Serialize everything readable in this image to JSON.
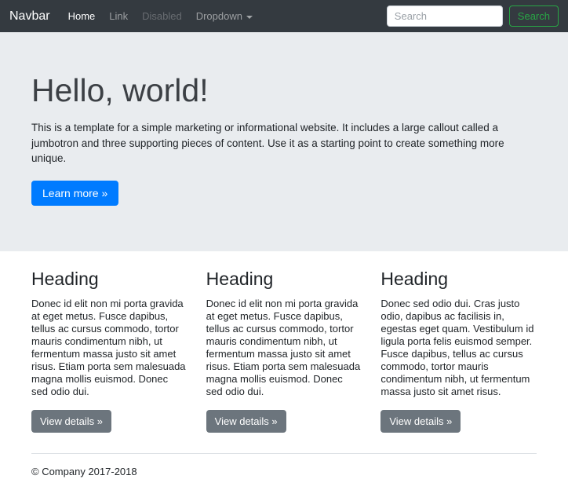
{
  "navbar": {
    "brand": "Navbar",
    "items": [
      {
        "label": "Home",
        "state": "active"
      },
      {
        "label": "Link",
        "state": "normal"
      },
      {
        "label": "Disabled",
        "state": "disabled"
      },
      {
        "label": "Dropdown",
        "state": "dropdown"
      }
    ],
    "search": {
      "placeholder": "Search",
      "button_label": "Search"
    }
  },
  "jumbotron": {
    "title": "Hello, world!",
    "description": "This is a template for a simple marketing or informational website. It includes a large callout called a jumbotron and three supporting pieces of content. Use it as a starting point to create something more unique.",
    "cta_label": "Learn more »"
  },
  "columns": [
    {
      "heading": "Heading",
      "text": "Donec id elit non mi porta gravida at eget metus. Fusce dapibus, tellus ac cursus commodo, tortor mauris condimentum nibh, ut fermentum massa justo sit amet risus. Etiam porta sem malesuada magna mollis euismod. Donec sed odio dui.",
      "button_label": "View details »"
    },
    {
      "heading": "Heading",
      "text": "Donec id elit non mi porta gravida at eget metus. Fusce dapibus, tellus ac cursus commodo, tortor mauris condimentum nibh, ut fermentum massa justo sit amet risus. Etiam porta sem malesuada magna mollis euismod. Donec sed odio dui.",
      "button_label": "View details »"
    },
    {
      "heading": "Heading",
      "text": "Donec sed odio dui. Cras justo odio, dapibus ac facilisis in, egestas eget quam. Vestibulum id ligula porta felis euismod semper. Fusce dapibus, tellus ac cursus commodo, tortor mauris condimentum nibh, ut fermentum massa justo sit amet risus.",
      "button_label": "View details »"
    }
  ],
  "footer": {
    "copyright": "© Company 2017-2018"
  },
  "colors": {
    "navbar_bg": "#343a40",
    "jumbotron_bg": "#e9ecef",
    "primary": "#007bff",
    "secondary": "#6c757d",
    "success": "#28a745"
  }
}
